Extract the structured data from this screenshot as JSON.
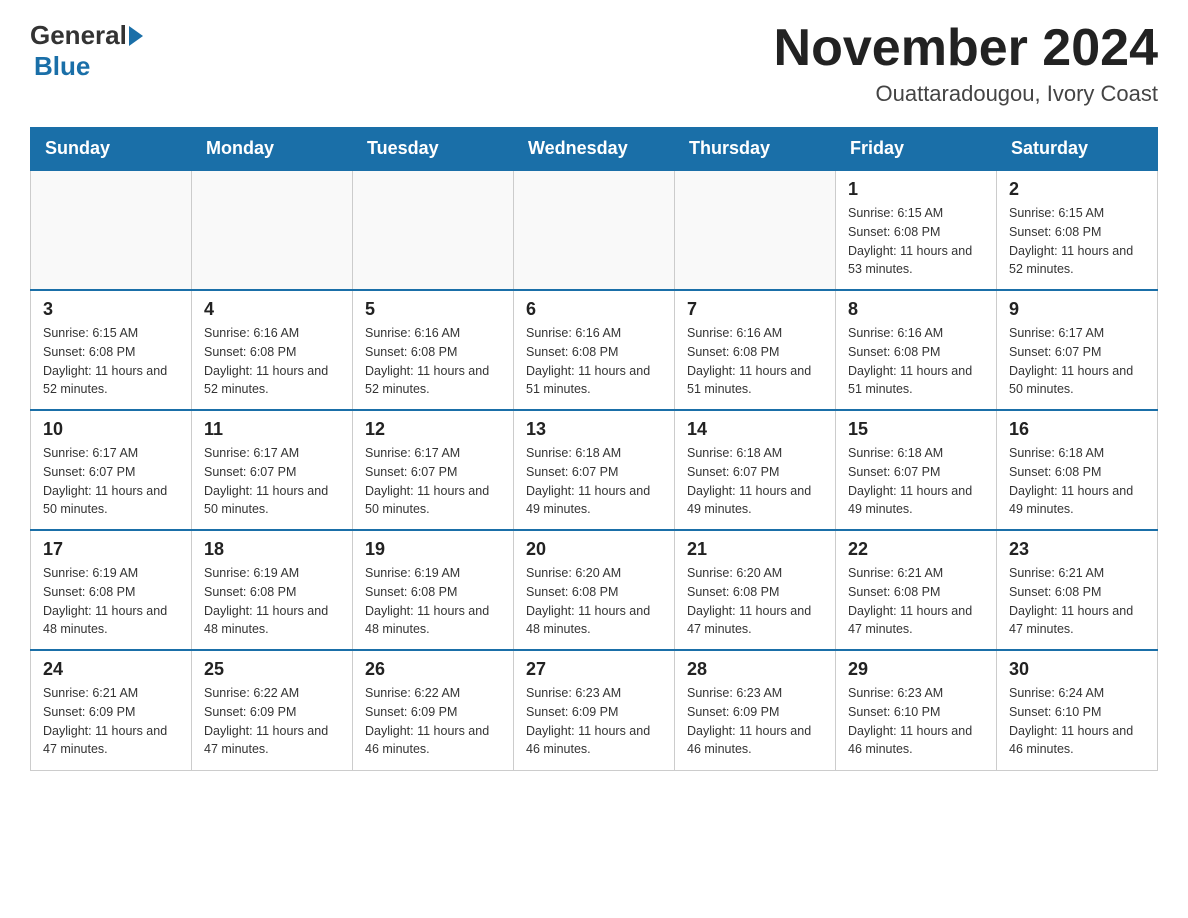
{
  "header": {
    "logo_general": "General",
    "logo_blue": "Blue",
    "month_title": "November 2024",
    "location": "Ouattaradougou, Ivory Coast"
  },
  "days_of_week": [
    "Sunday",
    "Monday",
    "Tuesday",
    "Wednesday",
    "Thursday",
    "Friday",
    "Saturday"
  ],
  "weeks": [
    [
      {
        "day": "",
        "info": ""
      },
      {
        "day": "",
        "info": ""
      },
      {
        "day": "",
        "info": ""
      },
      {
        "day": "",
        "info": ""
      },
      {
        "day": "",
        "info": ""
      },
      {
        "day": "1",
        "info": "Sunrise: 6:15 AM\nSunset: 6:08 PM\nDaylight: 11 hours and 53 minutes."
      },
      {
        "day": "2",
        "info": "Sunrise: 6:15 AM\nSunset: 6:08 PM\nDaylight: 11 hours and 52 minutes."
      }
    ],
    [
      {
        "day": "3",
        "info": "Sunrise: 6:15 AM\nSunset: 6:08 PM\nDaylight: 11 hours and 52 minutes."
      },
      {
        "day": "4",
        "info": "Sunrise: 6:16 AM\nSunset: 6:08 PM\nDaylight: 11 hours and 52 minutes."
      },
      {
        "day": "5",
        "info": "Sunrise: 6:16 AM\nSunset: 6:08 PM\nDaylight: 11 hours and 52 minutes."
      },
      {
        "day": "6",
        "info": "Sunrise: 6:16 AM\nSunset: 6:08 PM\nDaylight: 11 hours and 51 minutes."
      },
      {
        "day": "7",
        "info": "Sunrise: 6:16 AM\nSunset: 6:08 PM\nDaylight: 11 hours and 51 minutes."
      },
      {
        "day": "8",
        "info": "Sunrise: 6:16 AM\nSunset: 6:08 PM\nDaylight: 11 hours and 51 minutes."
      },
      {
        "day": "9",
        "info": "Sunrise: 6:17 AM\nSunset: 6:07 PM\nDaylight: 11 hours and 50 minutes."
      }
    ],
    [
      {
        "day": "10",
        "info": "Sunrise: 6:17 AM\nSunset: 6:07 PM\nDaylight: 11 hours and 50 minutes."
      },
      {
        "day": "11",
        "info": "Sunrise: 6:17 AM\nSunset: 6:07 PM\nDaylight: 11 hours and 50 minutes."
      },
      {
        "day": "12",
        "info": "Sunrise: 6:17 AM\nSunset: 6:07 PM\nDaylight: 11 hours and 50 minutes."
      },
      {
        "day": "13",
        "info": "Sunrise: 6:18 AM\nSunset: 6:07 PM\nDaylight: 11 hours and 49 minutes."
      },
      {
        "day": "14",
        "info": "Sunrise: 6:18 AM\nSunset: 6:07 PM\nDaylight: 11 hours and 49 minutes."
      },
      {
        "day": "15",
        "info": "Sunrise: 6:18 AM\nSunset: 6:07 PM\nDaylight: 11 hours and 49 minutes."
      },
      {
        "day": "16",
        "info": "Sunrise: 6:18 AM\nSunset: 6:08 PM\nDaylight: 11 hours and 49 minutes."
      }
    ],
    [
      {
        "day": "17",
        "info": "Sunrise: 6:19 AM\nSunset: 6:08 PM\nDaylight: 11 hours and 48 minutes."
      },
      {
        "day": "18",
        "info": "Sunrise: 6:19 AM\nSunset: 6:08 PM\nDaylight: 11 hours and 48 minutes."
      },
      {
        "day": "19",
        "info": "Sunrise: 6:19 AM\nSunset: 6:08 PM\nDaylight: 11 hours and 48 minutes."
      },
      {
        "day": "20",
        "info": "Sunrise: 6:20 AM\nSunset: 6:08 PM\nDaylight: 11 hours and 48 minutes."
      },
      {
        "day": "21",
        "info": "Sunrise: 6:20 AM\nSunset: 6:08 PM\nDaylight: 11 hours and 47 minutes."
      },
      {
        "day": "22",
        "info": "Sunrise: 6:21 AM\nSunset: 6:08 PM\nDaylight: 11 hours and 47 minutes."
      },
      {
        "day": "23",
        "info": "Sunrise: 6:21 AM\nSunset: 6:08 PM\nDaylight: 11 hours and 47 minutes."
      }
    ],
    [
      {
        "day": "24",
        "info": "Sunrise: 6:21 AM\nSunset: 6:09 PM\nDaylight: 11 hours and 47 minutes."
      },
      {
        "day": "25",
        "info": "Sunrise: 6:22 AM\nSunset: 6:09 PM\nDaylight: 11 hours and 47 minutes."
      },
      {
        "day": "26",
        "info": "Sunrise: 6:22 AM\nSunset: 6:09 PM\nDaylight: 11 hours and 46 minutes."
      },
      {
        "day": "27",
        "info": "Sunrise: 6:23 AM\nSunset: 6:09 PM\nDaylight: 11 hours and 46 minutes."
      },
      {
        "day": "28",
        "info": "Sunrise: 6:23 AM\nSunset: 6:09 PM\nDaylight: 11 hours and 46 minutes."
      },
      {
        "day": "29",
        "info": "Sunrise: 6:23 AM\nSunset: 6:10 PM\nDaylight: 11 hours and 46 minutes."
      },
      {
        "day": "30",
        "info": "Sunrise: 6:24 AM\nSunset: 6:10 PM\nDaylight: 11 hours and 46 minutes."
      }
    ]
  ]
}
